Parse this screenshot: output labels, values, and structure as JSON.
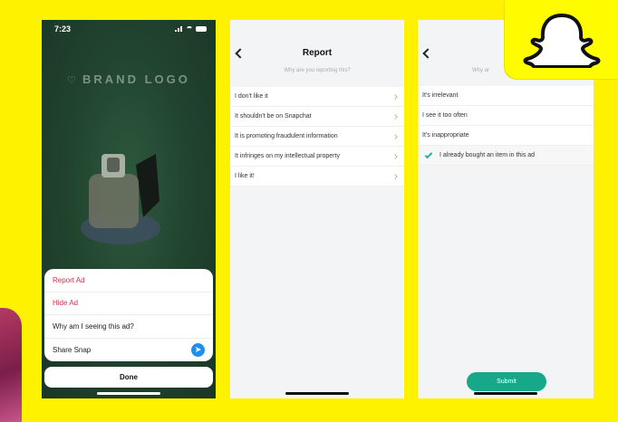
{
  "screens": {
    "ad": {
      "status_time": "7:23",
      "brand_logo": "BRAND LOGO",
      "sheet_items": [
        "Report Ad",
        "Hide Ad",
        "Why am I seeing this ad?",
        "Share Snap"
      ],
      "done_label": "Done"
    },
    "report": {
      "title": "Report",
      "subtitle": "Why are you reporting this?",
      "options": [
        "I don't like it",
        "It shouldn't be on Snapchat",
        "It is promoting fraudulent information",
        "It infringes on my intellectual property",
        "I like it!"
      ]
    },
    "reason": {
      "subtitle_partial": "Why ar",
      "options": [
        "It's irrelevant",
        "I see it too often",
        "It's inappropriate",
        "I already bought an item in this ad"
      ],
      "selected_option": "I already bought an item in this ad",
      "submit_label": "Submit"
    }
  },
  "colors": {
    "background": "#FFF200",
    "danger_text": "#D0304A",
    "accent_green": "#17A889",
    "share_blue": "#1D8FF1",
    "snap_yellow": "#FFFC00"
  },
  "icons": [
    "heart-icon",
    "share-icon",
    "back-icon",
    "chevron-right-icon",
    "check-icon",
    "snapchat-ghost-icon"
  ]
}
